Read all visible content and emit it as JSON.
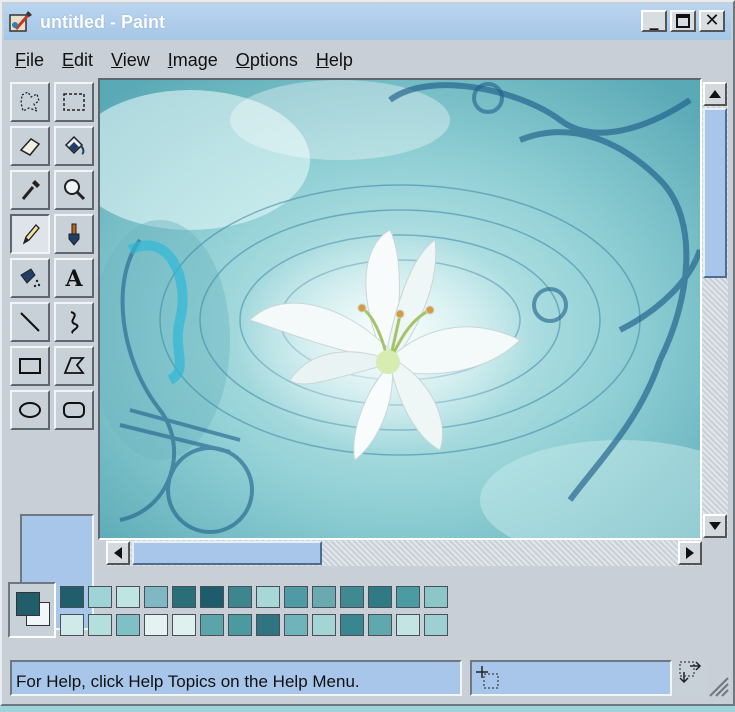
{
  "window": {
    "title": "untitled - Paint"
  },
  "menu": [
    {
      "label": "File",
      "key": "F",
      "rest": "ile"
    },
    {
      "label": "Edit",
      "key": "E",
      "rest": "dit"
    },
    {
      "label": "View",
      "key": "V",
      "rest": "iew"
    },
    {
      "label": "Image",
      "key": "I",
      "rest": "mage"
    },
    {
      "label": "Options",
      "key": "O",
      "rest": "ptions"
    },
    {
      "label": "Help",
      "key": "H",
      "rest": "elp"
    }
  ],
  "tools": [
    {
      "name": "free-form-select",
      "icon": "free-form-select-icon"
    },
    {
      "name": "rectangle-select",
      "icon": "rectangle-select-icon"
    },
    {
      "name": "eraser",
      "icon": "eraser-icon"
    },
    {
      "name": "fill-with-color",
      "icon": "fill-bucket-icon"
    },
    {
      "name": "pick-color",
      "icon": "eyedropper-icon"
    },
    {
      "name": "magnifier",
      "icon": "magnifier-icon"
    },
    {
      "name": "pencil",
      "icon": "pencil-icon",
      "active": true
    },
    {
      "name": "brush",
      "icon": "brush-icon"
    },
    {
      "name": "airbrush",
      "icon": "airbrush-icon"
    },
    {
      "name": "text",
      "icon": "text-icon",
      "glyph": "A"
    },
    {
      "name": "line",
      "icon": "line-icon"
    },
    {
      "name": "curve",
      "icon": "curve-icon"
    },
    {
      "name": "rectangle",
      "icon": "rectangle-icon"
    },
    {
      "name": "polygon",
      "icon": "polygon-icon"
    },
    {
      "name": "ellipse",
      "icon": "ellipse-icon"
    },
    {
      "name": "rounded-rectangle",
      "icon": "rounded-rectangle-icon"
    }
  ],
  "colors": {
    "foreground": "#1f5e6a",
    "background": "#f1f6f8",
    "palette_top": [
      "#1f5e6a",
      "#9fd4d6",
      "#bfe4e2",
      "#7fb8c4",
      "#2a6e78",
      "#1c5c6c",
      "#3d8690",
      "#a7d7d6",
      "#4f9aa4",
      "#68aab0",
      "#3f8a92",
      "#2f7a84",
      "#4a9ca2",
      "#8cc7c8"
    ],
    "palette_bottom": [
      "#cfeae8",
      "#b4dfdc",
      "#7fc0c6",
      "#e4f3f1",
      "#dff1ef",
      "#5aa4aa",
      "#4a9aa0",
      "#2f7480",
      "#6fb4ba",
      "#a4d4d4",
      "#3a8690",
      "#5fa8ae",
      "#c2e4e2",
      "#9ecfd2"
    ]
  },
  "status": {
    "help_text": "For Help, click Help Topics on the Help Menu.",
    "position": "",
    "size": ""
  }
}
